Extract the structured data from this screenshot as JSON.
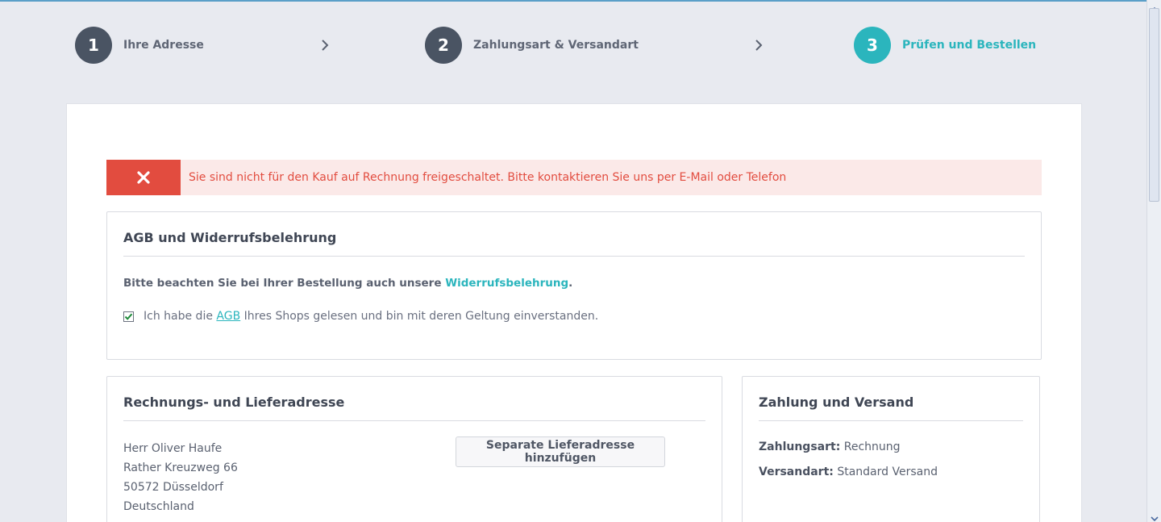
{
  "steps": [
    {
      "num": "1",
      "label": "Ihre Adresse"
    },
    {
      "num": "2",
      "label": "Zahlungsart & Versandart"
    },
    {
      "num": "3",
      "label": "Prüfen und Bestellen"
    }
  ],
  "alert": {
    "message": "Sie sind nicht für den Kauf auf Rechnung freigeschaltet. Bitte kontaktieren Sie uns per E-Mail oder Telefon"
  },
  "agb": {
    "title": "AGB und Widerrufsbelehrung",
    "notice_prefix": "Bitte beachten Sie bei Ihrer Bestellung auch unsere ",
    "notice_link": "Widerrufsbelehrung",
    "notice_suffix": ".",
    "checkbox_prefix": "Ich habe die ",
    "checkbox_link": "AGB",
    "checkbox_suffix": " Ihres Shops gelesen und bin mit deren Geltung einverstanden.",
    "checked": true
  },
  "address": {
    "title": "Rechnungs- und Lieferadresse",
    "lines": [
      "Herr Oliver Haufe",
      "Rather Kreuzweg 66",
      "50572 Düsseldorf",
      "Deutschland"
    ],
    "add_button": "Separate Lieferadresse hinzufügen"
  },
  "payment": {
    "title": "Zahlung und Versand",
    "payment_label": "Zahlungsart:",
    "payment_value": " Rechnung",
    "shipping_label": "Versandart:",
    "shipping_value": " Standard Versand"
  },
  "colors": {
    "accent": "#2bb5bd",
    "error": "#e24c3f",
    "step_inactive": "#4a5463"
  }
}
